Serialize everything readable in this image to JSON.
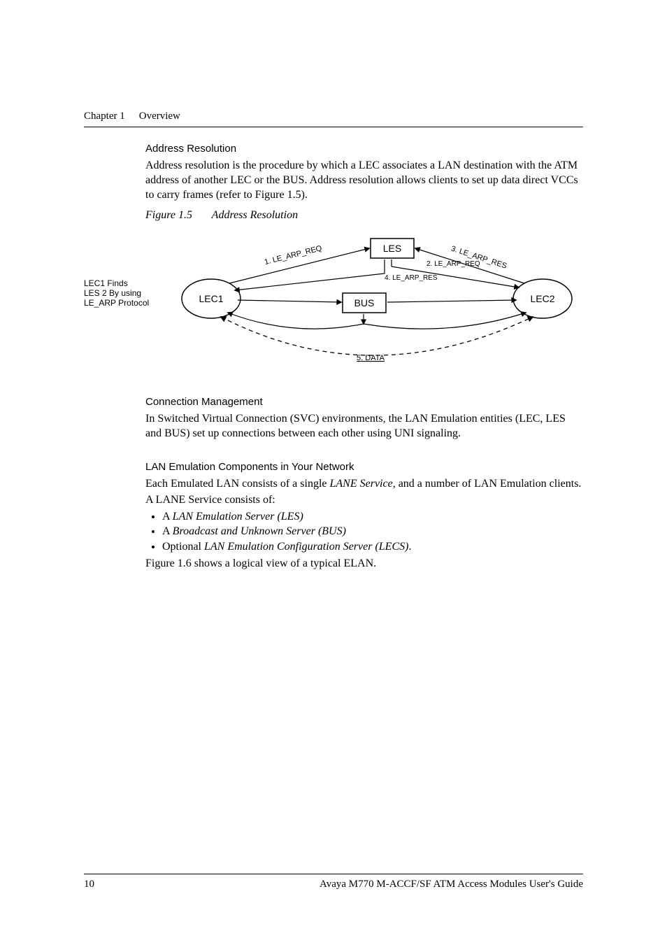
{
  "header": {
    "chapter_num": "Chapter 1",
    "chapter_title": "Overview"
  },
  "section1": {
    "heading": "Address Resolution",
    "body": "Address resolution is the procedure by which a LEC associates a LAN destination with the ATM address of another LEC or the BUS. Address resolution allows clients to set up data direct VCCs to carry frames (refer to Figure 1.5)."
  },
  "figure": {
    "label": "Figure 1.5",
    "title": "Address Resolution",
    "diagram": {
      "side_caption": {
        "line1": "LEC1 Finds",
        "line2": "LES 2 By using",
        "line3": "LE_ARP Protocol"
      },
      "lec1": "LEC1",
      "lec2": "LEC2",
      "les": "LES",
      "bus": "BUS",
      "step1": "1. LE_ARP_REQ",
      "step2": "2. LE_ARP_REQ",
      "step3": "3. LE_ARP_RES",
      "step4": "4. LE_ARP_RES",
      "step5": "5. DATA"
    }
  },
  "section2": {
    "heading": "Connection Management",
    "body": "In Switched Virtual Connection (SVC) environments, the LAN Emulation entities (LEC, LES and BUS) set up connections between each other using UNI signaling."
  },
  "section3": {
    "heading": "LAN Emulation Components in Your Network",
    "body1a": "Each Emulated LAN consists of a single ",
    "body1_italic": "LANE Service",
    "body1b": ", and a number of LAN Emulation clients.",
    "body2": "A LANE Service consists of:",
    "list": [
      {
        "prefix": "A ",
        "italic": "LAN Emulation Server (LES)"
      },
      {
        "prefix": "A ",
        "italic": "Broadcast and Unknown Server (BUS)"
      },
      {
        "prefix": "Optional ",
        "italic": "LAN Emulation Configuration Server (LECS)",
        "suffix": "."
      }
    ],
    "body3": "Figure 1.6 shows a logical view of a typical ELAN."
  },
  "footer": {
    "page_num": "10",
    "doc_title": "Avaya M770 M-ACCF/SF ATM Access Modules User's Guide"
  }
}
